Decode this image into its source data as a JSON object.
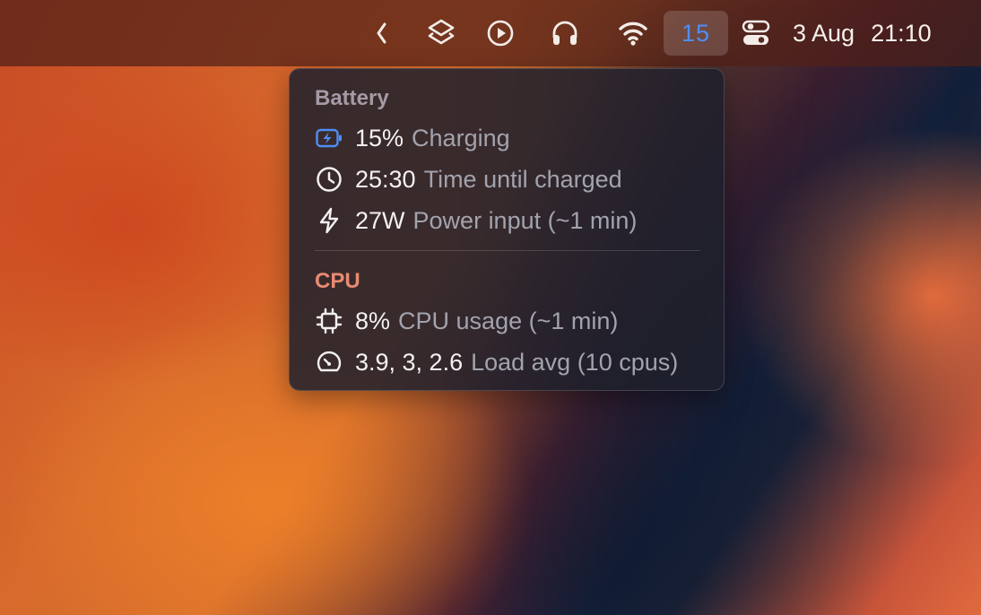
{
  "menubar": {
    "items": [
      {
        "icon": "chevron-left-icon"
      },
      {
        "icon": "layers-icon"
      },
      {
        "icon": "play-circle-icon"
      },
      {
        "icon": "headphones-icon"
      },
      {
        "icon": "wifi-icon"
      }
    ],
    "battery_badge": "15",
    "control_icon": "control-center-icon",
    "date": "3 Aug",
    "time": "21:10"
  },
  "popover": {
    "battery": {
      "title": "Battery",
      "rows": [
        {
          "icon": "battery-charging-icon",
          "value": "15%",
          "label": "Charging"
        },
        {
          "icon": "clock-icon",
          "value": "25:30",
          "label": "Time until charged"
        },
        {
          "icon": "bolt-icon",
          "value": "27W",
          "label": "Power input (~1 min)"
        }
      ]
    },
    "cpu": {
      "title": "CPU",
      "rows": [
        {
          "icon": "cpu-chip-icon",
          "value": "8%",
          "label": "CPU usage (~1 min)"
        },
        {
          "icon": "gauge-icon",
          "value": "3.9, 3, 2.6",
          "label": "Load avg (10 cpus)"
        }
      ]
    }
  },
  "colors": {
    "accent_blue": "#4f8df5",
    "cpu_title": "#e88a72",
    "battery_title": "#a59aa6"
  }
}
